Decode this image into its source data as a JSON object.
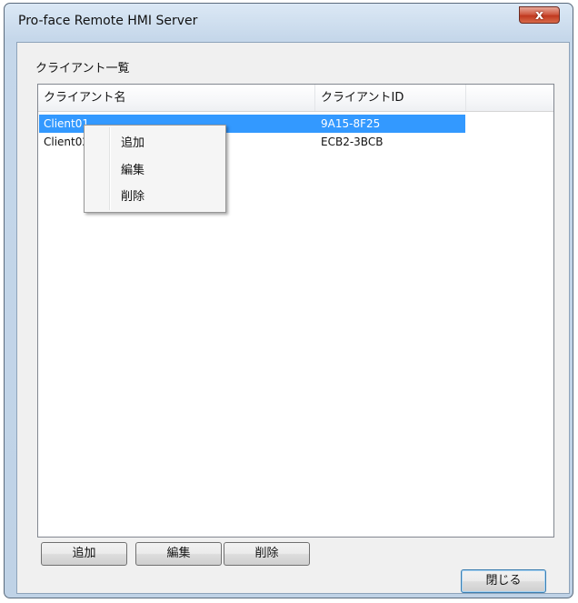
{
  "window": {
    "title": "Pro-face Remote HMI Server",
    "close_symbol": "x"
  },
  "group_label": "クライアント一覧",
  "listview": {
    "columns": [
      "クライアント名",
      "クライアントID"
    ],
    "rows": [
      {
        "name": "Client01",
        "id": "9A15-8F25",
        "selected": true
      },
      {
        "name": "Client02",
        "id": "ECB2-3BCB",
        "selected": false
      }
    ]
  },
  "context_menu": {
    "items": [
      "追加",
      "編集",
      "削除"
    ]
  },
  "buttons": {
    "add": "追加",
    "edit": "編集",
    "delete": "削除",
    "close": "閉じる"
  },
  "colors": {
    "selection": "#3399ff",
    "close_button": "#c0391f"
  }
}
